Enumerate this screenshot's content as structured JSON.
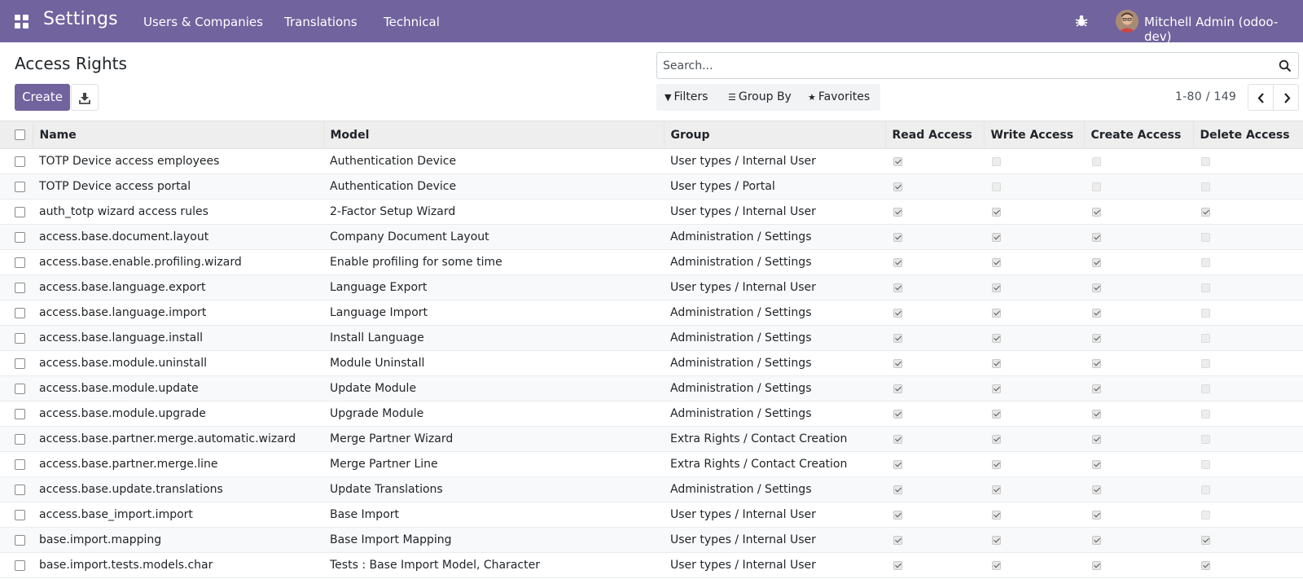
{
  "navbar": {
    "app_title": "Settings",
    "menu": [
      "Users & Companies",
      "Translations",
      "Technical"
    ],
    "user_name": "Mitchell Admin (odoo-dev)",
    "bg_color": "#71639e"
  },
  "control_panel": {
    "title": "Access Rights",
    "create_label": "Create",
    "search_placeholder": "Search...",
    "filters_label": "Filters",
    "group_by_label": "Group By",
    "favorites_label": "Favorites",
    "pager_value": "1-80 / 149"
  },
  "table": {
    "columns": [
      "Name",
      "Model",
      "Group",
      "Read Access",
      "Write Access",
      "Create Access",
      "Delete Access"
    ],
    "rows": [
      {
        "name": "TOTP Device access employees",
        "model": "Authentication Device",
        "group": "User types / Internal User",
        "read": true,
        "write": false,
        "create": false,
        "delete": false
      },
      {
        "name": "TOTP Device access portal",
        "model": "Authentication Device",
        "group": "User types / Portal",
        "read": true,
        "write": false,
        "create": false,
        "delete": false
      },
      {
        "name": "auth_totp wizard access rules",
        "model": "2-Factor Setup Wizard",
        "group": "User types / Internal User",
        "read": true,
        "write": true,
        "create": true,
        "delete": true
      },
      {
        "name": "access.base.document.layout",
        "model": "Company Document Layout",
        "group": "Administration / Settings",
        "read": true,
        "write": true,
        "create": true,
        "delete": false
      },
      {
        "name": "access.base.enable.profiling.wizard",
        "model": "Enable profiling for some time",
        "group": "Administration / Settings",
        "read": true,
        "write": true,
        "create": true,
        "delete": false
      },
      {
        "name": "access.base.language.export",
        "model": "Language Export",
        "group": "User types / Internal User",
        "read": true,
        "write": true,
        "create": true,
        "delete": false
      },
      {
        "name": "access.base.language.import",
        "model": "Language Import",
        "group": "Administration / Settings",
        "read": true,
        "write": true,
        "create": true,
        "delete": false
      },
      {
        "name": "access.base.language.install",
        "model": "Install Language",
        "group": "Administration / Settings",
        "read": true,
        "write": true,
        "create": true,
        "delete": false
      },
      {
        "name": "access.base.module.uninstall",
        "model": "Module Uninstall",
        "group": "Administration / Settings",
        "read": true,
        "write": true,
        "create": true,
        "delete": false
      },
      {
        "name": "access.base.module.update",
        "model": "Update Module",
        "group": "Administration / Settings",
        "read": true,
        "write": true,
        "create": true,
        "delete": false
      },
      {
        "name": "access.base.module.upgrade",
        "model": "Upgrade Module",
        "group": "Administration / Settings",
        "read": true,
        "write": true,
        "create": true,
        "delete": false
      },
      {
        "name": "access.base.partner.merge.automatic.wizard",
        "model": "Merge Partner Wizard",
        "group": "Extra Rights / Contact Creation",
        "read": true,
        "write": true,
        "create": true,
        "delete": false
      },
      {
        "name": "access.base.partner.merge.line",
        "model": "Merge Partner Line",
        "group": "Extra Rights / Contact Creation",
        "read": true,
        "write": true,
        "create": true,
        "delete": false
      },
      {
        "name": "access.base.update.translations",
        "model": "Update Translations",
        "group": "Administration / Settings",
        "read": true,
        "write": true,
        "create": true,
        "delete": false
      },
      {
        "name": "access.base_import.import",
        "model": "Base Import",
        "group": "User types / Internal User",
        "read": true,
        "write": true,
        "create": true,
        "delete": false
      },
      {
        "name": "base.import.mapping",
        "model": "Base Import Mapping",
        "group": "User types / Internal User",
        "read": true,
        "write": true,
        "create": true,
        "delete": true
      },
      {
        "name": "base.import.tests.models.char",
        "model": "Tests : Base Import Model, Character",
        "group": "User types / Internal User",
        "read": true,
        "write": true,
        "create": true,
        "delete": true
      }
    ]
  }
}
